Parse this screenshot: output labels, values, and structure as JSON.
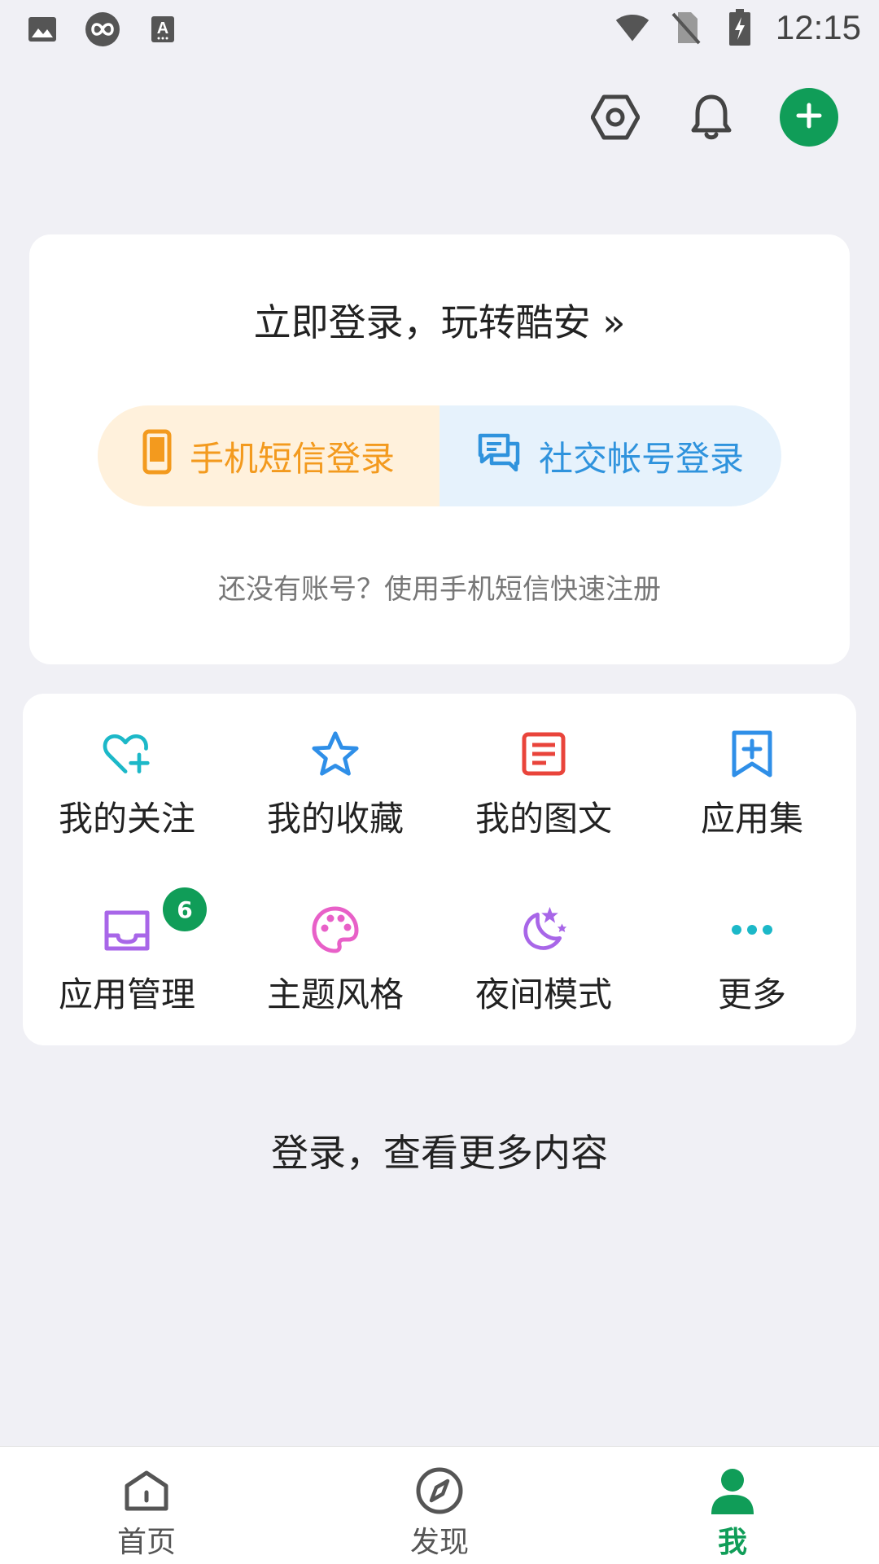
{
  "status_bar": {
    "time": "12:15",
    "left_icons": [
      "image-icon",
      "infinity-app-icon",
      "font-icon"
    ],
    "right_icons": [
      "wifi-icon",
      "no-sim-icon",
      "battery-charging-icon"
    ]
  },
  "top_actions": {
    "icons": [
      "settings-icon",
      "bell-icon",
      "add-icon"
    ],
    "add_color": "#109d58"
  },
  "login_card": {
    "title": "立即登录，玩转酷安 »",
    "sms_login_label": "手机短信登录",
    "social_login_label": "社交帐号登录",
    "register_hint": "还没有账号？使用手机短信快速注册",
    "sms_color": "#f39a1e",
    "social_color": "#2f93dd"
  },
  "menu": {
    "items": [
      {
        "label": "我的关注",
        "icon": "heart-plus-icon",
        "color": "#1cb8c8"
      },
      {
        "label": "我的收藏",
        "icon": "star-icon",
        "color": "#2f8fe8"
      },
      {
        "label": "我的图文",
        "icon": "article-icon",
        "color": "#e9443b"
      },
      {
        "label": "应用集",
        "icon": "bookmark-add-icon",
        "color": "#2f8fe8"
      },
      {
        "label": "应用管理",
        "icon": "inbox-icon",
        "color": "#a866e8",
        "badge": "6"
      },
      {
        "label": "主题风格",
        "icon": "palette-icon",
        "color": "#e860c8"
      },
      {
        "label": "夜间模式",
        "icon": "moon-stars-icon",
        "color": "#a866e8"
      },
      {
        "label": "更多",
        "icon": "more-dots-icon",
        "color": "#1cb8c8"
      }
    ]
  },
  "more_hint": "登录，查看更多内容",
  "bottom_nav": {
    "items": [
      {
        "label": "首页",
        "icon": "home-icon"
      },
      {
        "label": "发现",
        "icon": "compass-icon"
      },
      {
        "label": "我",
        "icon": "person-icon",
        "active": true
      }
    ],
    "active_color": "#109d58"
  }
}
